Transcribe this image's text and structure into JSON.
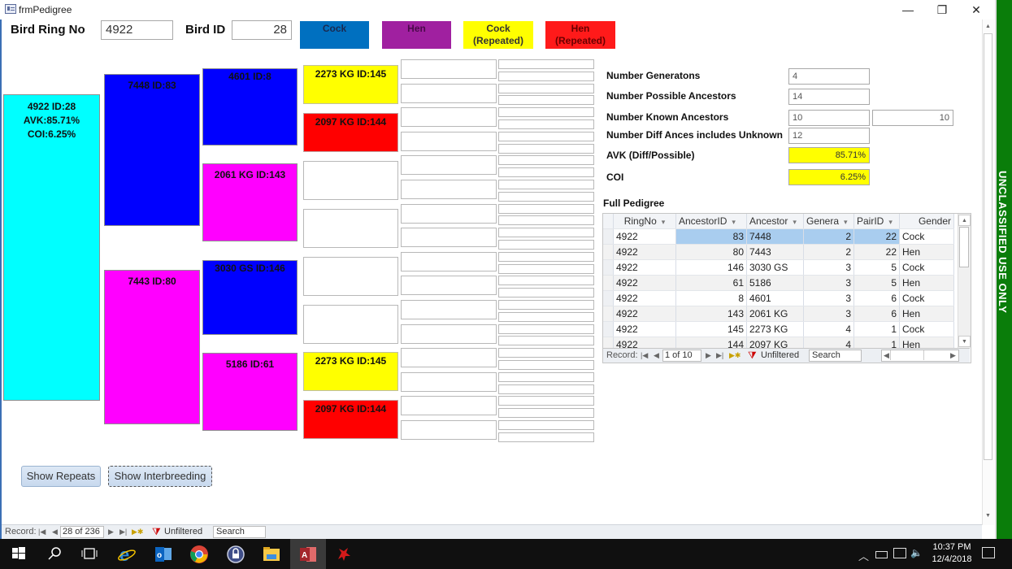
{
  "window": {
    "title": "frmPedigree",
    "minimize_glyph": "—",
    "restore_glyph": "❐",
    "close_glyph": "✕"
  },
  "header": {
    "ring_label": "Bird Ring No",
    "ring_value": "4922",
    "id_label": "Bird ID",
    "id_value": "28"
  },
  "legend": [
    {
      "label": "Cock",
      "color": "#0070c0"
    },
    {
      "label": "Hen",
      "color": "#a020a0"
    },
    {
      "label": "Cock\n(Repeated)",
      "line1": "Cock",
      "line2": "(Repeated)",
      "color": "#ffff00"
    },
    {
      "label": "Hen\n(Repeated)",
      "line1": "Hen",
      "line2": "(Repeated)",
      "color": "#ff0000"
    }
  ],
  "colors": {
    "subject": "#00ffff",
    "cock": "#0000ff",
    "hen": "#ff00ff",
    "cock_repeated": "#ffff00",
    "hen_repeated": "#ff0000",
    "banner": "#0a7d0a",
    "row_highlight": "#a9cdef"
  },
  "pedigree": {
    "subject": {
      "line1": "4922 ID:28",
      "line2": "AVK:85.71%",
      "line3": "COI:6.25%"
    },
    "gen2": [
      {
        "label": "7448 ID:83",
        "type": "cock"
      },
      {
        "label": "7443 ID:80",
        "type": "hen"
      }
    ],
    "gen3": [
      {
        "label": "4601 ID:8",
        "type": "cock"
      },
      {
        "label": "2061 KG ID:143",
        "type": "hen"
      },
      {
        "label": "3030 GS ID:146",
        "type": "cock"
      },
      {
        "label": "5186 ID:61",
        "type": "hen"
      }
    ],
    "gen4": [
      {
        "label": "2273 KG ID:145",
        "type": "cock_repeated"
      },
      {
        "label": "2097 KG ID:144",
        "type": "hen_repeated"
      },
      {
        "label": "",
        "type": "empty"
      },
      {
        "label": "",
        "type": "empty"
      },
      {
        "label": "",
        "type": "empty"
      },
      {
        "label": "",
        "type": "empty"
      },
      {
        "label": "2273 KG ID:145",
        "type": "cock_repeated"
      },
      {
        "label": "2097 KG ID:144",
        "type": "hen_repeated"
      }
    ]
  },
  "stats": {
    "generations": {
      "label": "Number Generatons",
      "value": "4"
    },
    "possible": {
      "label": "Number Possible Ancestors",
      "value": "14"
    },
    "known": {
      "label": "Number Known Ancestors",
      "value": "10",
      "value2": "10"
    },
    "diff": {
      "label": "Number  Diff Ances includes Unknown",
      "value": "12"
    },
    "avk": {
      "label": "AVK (Diff/Possible)",
      "value": "85.71%"
    },
    "coi": {
      "label": "COI",
      "value": "6.25%"
    }
  },
  "full_pedigree": {
    "title": "Full Pedigree",
    "columns": [
      "RingNo",
      "AncestorID",
      "Ancestor",
      "Genera",
      "PairID",
      "Gender"
    ],
    "rows": [
      [
        "4922",
        "83",
        "7448",
        "2",
        "22",
        "Cock"
      ],
      [
        "4922",
        "80",
        "7443",
        "2",
        "22",
        "Hen"
      ],
      [
        "4922",
        "146",
        "3030 GS",
        "3",
        "5",
        "Cock"
      ],
      [
        "4922",
        "61",
        "5186",
        "3",
        "5",
        "Hen"
      ],
      [
        "4922",
        "8",
        "4601",
        "3",
        "6",
        "Cock"
      ],
      [
        "4922",
        "143",
        "2061 KG",
        "3",
        "6",
        "Hen"
      ],
      [
        "4922",
        "145",
        "2273 KG",
        "4",
        "1",
        "Cock"
      ],
      [
        "4922",
        "144",
        "2097 KG",
        "4",
        "1",
        "Hen"
      ]
    ],
    "nav": {
      "record_label": "Record:",
      "position": "1 of 10",
      "filter": "Unfiltered",
      "search": "Search"
    }
  },
  "buttons": {
    "show_repeats": "Show Repeats",
    "show_interbreeding": "Show Interbreeding"
  },
  "form_nav": {
    "record_label": "Record:",
    "position": "28 of 236",
    "filter": "Unfiltered",
    "search": "Search"
  },
  "banner": {
    "text": "UNCLASSIFIED USE ONLY"
  },
  "taskbar": {
    "apps": [
      "start",
      "search",
      "task-view",
      "internet-explorer",
      "outlook",
      "chrome",
      "keepass",
      "file-explorer",
      "access",
      "red-app"
    ],
    "time": "10:37 PM",
    "date": "12/4/2018"
  }
}
